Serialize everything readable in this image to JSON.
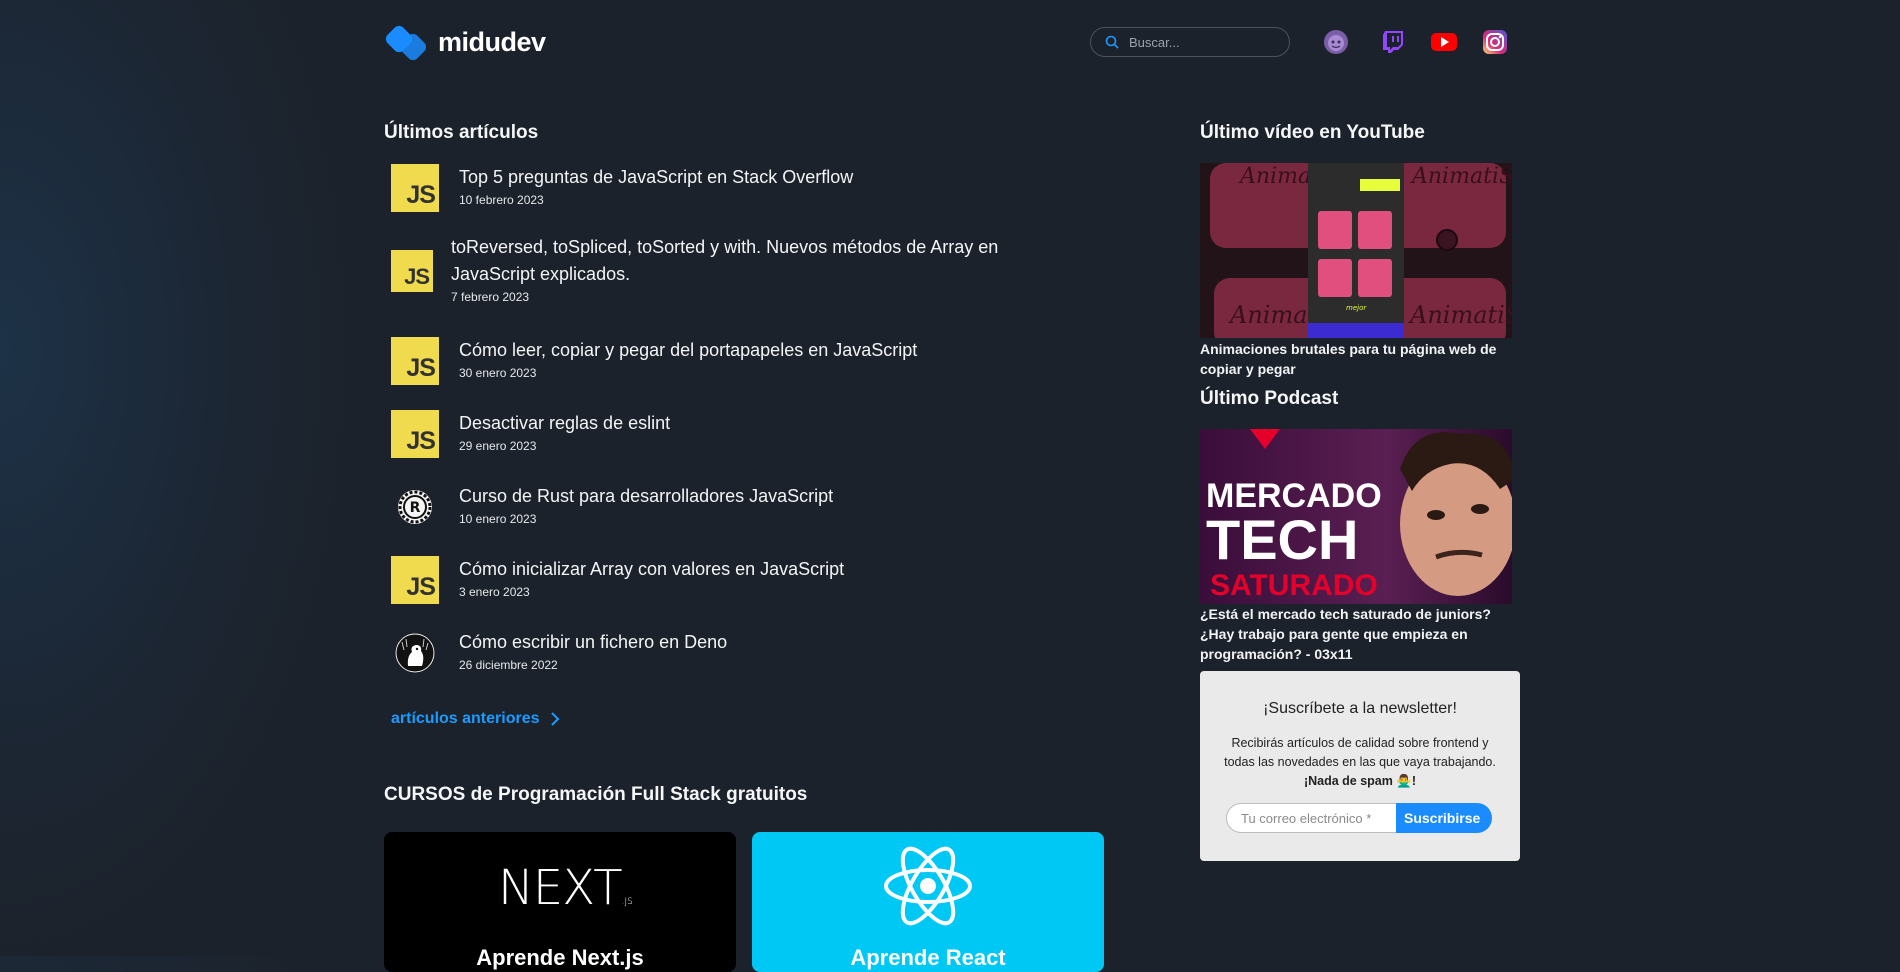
{
  "brand": {
    "name": "midudev"
  },
  "search": {
    "placeholder": "Buscar..."
  },
  "colors": {
    "accent": "#1a8cff",
    "js_yellow": "#f0db4f",
    "background": "#1c222b"
  },
  "social": [
    "avatar-icon",
    "twitch-icon",
    "youtube-icon",
    "instagram-icon"
  ],
  "articles_section": {
    "title": "Últimos artículos",
    "items": [
      {
        "title": "Top 5 preguntas de JavaScript en Stack Overflow",
        "date": "10 febrero 2023",
        "icon": "js-icon"
      },
      {
        "title": "toReversed, toSpliced, toSorted y with. Nuevos métodos de Array en JavaScript explicados.",
        "date": "7 febrero 2023",
        "icon": "js-icon"
      },
      {
        "title": "Cómo leer, copiar y pegar del portapapeles en JavaScript",
        "date": "30 enero 2023",
        "icon": "js-icon"
      },
      {
        "title": "Desactivar reglas de eslint",
        "date": "29 enero 2023",
        "icon": "js-icon"
      },
      {
        "title": "Curso de Rust para desarrolladores JavaScript",
        "date": "10 enero 2023",
        "icon": "rust-icon"
      },
      {
        "title": "Cómo inicializar Array con valores en JavaScript",
        "date": "3 enero 2023",
        "icon": "js-icon"
      },
      {
        "title": "Cómo escribir un fichero en Deno",
        "date": "26 diciembre 2022",
        "icon": "deno-icon"
      }
    ],
    "more_label": "artículos anteriores"
  },
  "courses": {
    "title": "CURSOS de Programación Full Stack gratuitos",
    "cards": [
      {
        "label": "Aprende Next.js",
        "logo": "NEXT",
        "logo_sub": ".JS"
      },
      {
        "label": "Aprende React"
      }
    ]
  },
  "youtube": {
    "title": "Último vídeo en YouTube",
    "caption": "Animaciones brutales para tu página web de copiar y pegar",
    "thumb_texts": [
      "AnimatiSS",
      "AnimatiSS",
      "AnimatiSS",
      "AnimatiSS",
      "mejor"
    ]
  },
  "podcast": {
    "title": "Último Podcast",
    "caption": "¿Está el mercado tech saturado de juniors? ¿Hay trabajo para gente que empieza en programación? - 03x11",
    "thumb_line1": "MERCADO",
    "thumb_line2": "TECH",
    "thumb_line3": "SATURADO"
  },
  "newsletter": {
    "title": "¡Suscríbete a la newsletter!",
    "text": "Recibirás artículos de calidad sobre frontend y todas las novedades en las que vaya trabajando.",
    "bold": "¡Nada de spam 🙅‍♂️!",
    "placeholder": "Tu correo electrónico *",
    "button": "Suscribirse"
  }
}
